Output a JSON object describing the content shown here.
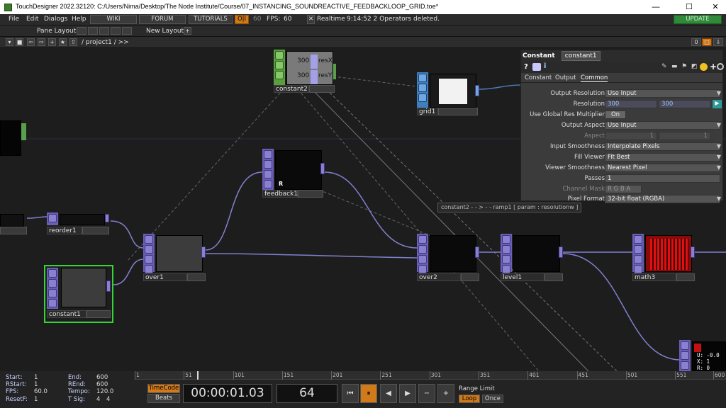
{
  "window": {
    "title": "TouchDesigner 2022.32120: C:/Users/Nima/Desktop/The Node Institute/Course/07_INSTANCING_SOUNDREACTIVE_FEEDBACKLOOP_GRID.toe*",
    "minimize": "—",
    "maximize": "☐",
    "close": "✕"
  },
  "menu": {
    "items": [
      "File",
      "Edit",
      "Dialogs",
      "Help"
    ],
    "wiki": "WIKI",
    "forum": "FORUM",
    "tutorials": "TUTORIALS",
    "oi": "O|I",
    "fps_target": "60",
    "fps_label": "FPS:",
    "fps_value": "60",
    "realtime_check": "✕",
    "realtime_label": "Realtime",
    "status": "9:14:52 2 Operators deleted.",
    "update": "UPDATE"
  },
  "toolbar": {
    "pane_layout": "Pane Layout",
    "new_layout": "New Layout",
    "plus": "+"
  },
  "pathbar": {
    "path": "/ project1 / >>",
    "zero": "0"
  },
  "nodes": {
    "constant2": {
      "name": "constant2",
      "resx_val": "300",
      "resx": "resX",
      "resy_val": "300",
      "resy": "resY"
    },
    "grid1": {
      "name": "grid1"
    },
    "feedback1": {
      "name": "feedback1",
      "r": "R"
    },
    "reorder1": {
      "name": "reorder1"
    },
    "over1": {
      "name": "over1"
    },
    "constant1": {
      "name": "constant1"
    },
    "over2": {
      "name": "over2"
    },
    "level1": {
      "name": "level1"
    },
    "math3": {
      "name": "math3"
    },
    "partial": {
      "u": "U: -0.0",
      "x": "X: 1",
      "r": "R: 0"
    }
  },
  "tooltip": "constant2 - - > - - ramp1 [ param : resolutionw ]",
  "params": {
    "op_type": "Constant",
    "op_name": "constant1",
    "tabs": [
      "Constant",
      "Output",
      "Common"
    ],
    "active_tab": "Common",
    "rows": [
      {
        "label": "Output Resolution",
        "value": "Use Input"
      },
      {
        "label": "Resolution",
        "value": "300",
        "value2": "300"
      },
      {
        "label": "Use Global Res Multiplier",
        "value": "On"
      },
      {
        "label": "Output Aspect",
        "value": "Use Input"
      },
      {
        "label": "Aspect",
        "value": "1",
        "value2": "1"
      },
      {
        "label": "Input Smoothness",
        "value": "Interpolate Pixels"
      },
      {
        "label": "Fill Viewer",
        "value": "Fit Best"
      },
      {
        "label": "Viewer Smoothness",
        "value": "Nearest Pixel"
      },
      {
        "label": "Passes",
        "value": "1"
      },
      {
        "label": "Channel Mask",
        "value": "R G B A"
      },
      {
        "label": "Pixel Format",
        "value": "32-bit float (RGBA)"
      }
    ]
  },
  "timeline": {
    "start_label": "Start:",
    "start": "1",
    "rstart_label": "RStart:",
    "rstart": "1",
    "fps_label": "FPS:",
    "fps": "60.0",
    "resetf_label": "ResetF:",
    "resetf": "1",
    "end_label": "End:",
    "end": "600",
    "rend_label": "REnd:",
    "rend": "600",
    "tempo_label": "Tempo:",
    "tempo": "120.0",
    "tsig_label": "T Sig:",
    "tsig1": "4",
    "tsig2": "4",
    "ruler": [
      "1",
      "51",
      "101",
      "151",
      "201",
      "251",
      "301",
      "351",
      "401",
      "451",
      "501",
      "551",
      "600"
    ],
    "timecode_btn": "TimeCode",
    "beats_btn": "Beats",
    "timecode": "00:00:01.03",
    "frame": "64",
    "range_limit": "Range Limit",
    "loop": "Loop",
    "once": "Once",
    "transport": [
      "⏮",
      "⏸",
      "◀",
      "▶",
      "−",
      "+"
    ]
  }
}
